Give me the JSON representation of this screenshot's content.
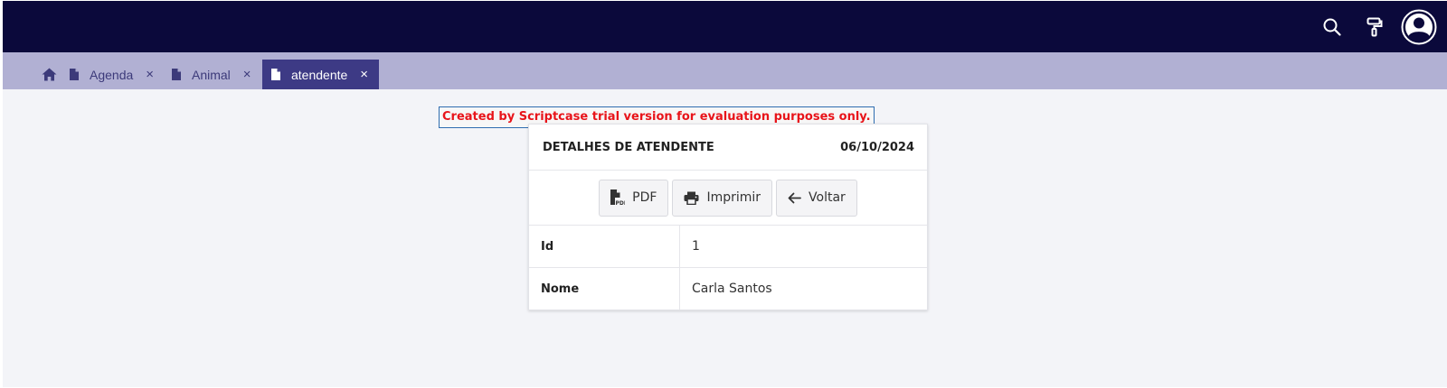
{
  "topbar": {
    "icons": [
      "search-icon",
      "paint-roller-icon",
      "user-avatar-icon"
    ]
  },
  "tabs": {
    "home_icon": "home-icon",
    "items": [
      {
        "label": "Agenda",
        "active": false
      },
      {
        "label": "Animal",
        "active": false
      },
      {
        "label": "atendente",
        "active": true
      }
    ],
    "close_glyph": "×"
  },
  "trial_notice": "Created by Scriptcase trial version for evaluation purposes only.",
  "card": {
    "title": "DETALHES DE ATENDENTE",
    "date": "06/10/2024",
    "buttons": {
      "pdf": "PDF",
      "print": "Imprimir",
      "back": "Voltar"
    },
    "rows": [
      {
        "label": "Id",
        "value": "1"
      },
      {
        "label": "Nome",
        "value": "Carla Santos"
      }
    ]
  },
  "colors": {
    "topbar": "#0b093b",
    "tabbar": "#b1b0d3",
    "active_tab": "#3d3a85",
    "trial_text": "#e8141a"
  }
}
